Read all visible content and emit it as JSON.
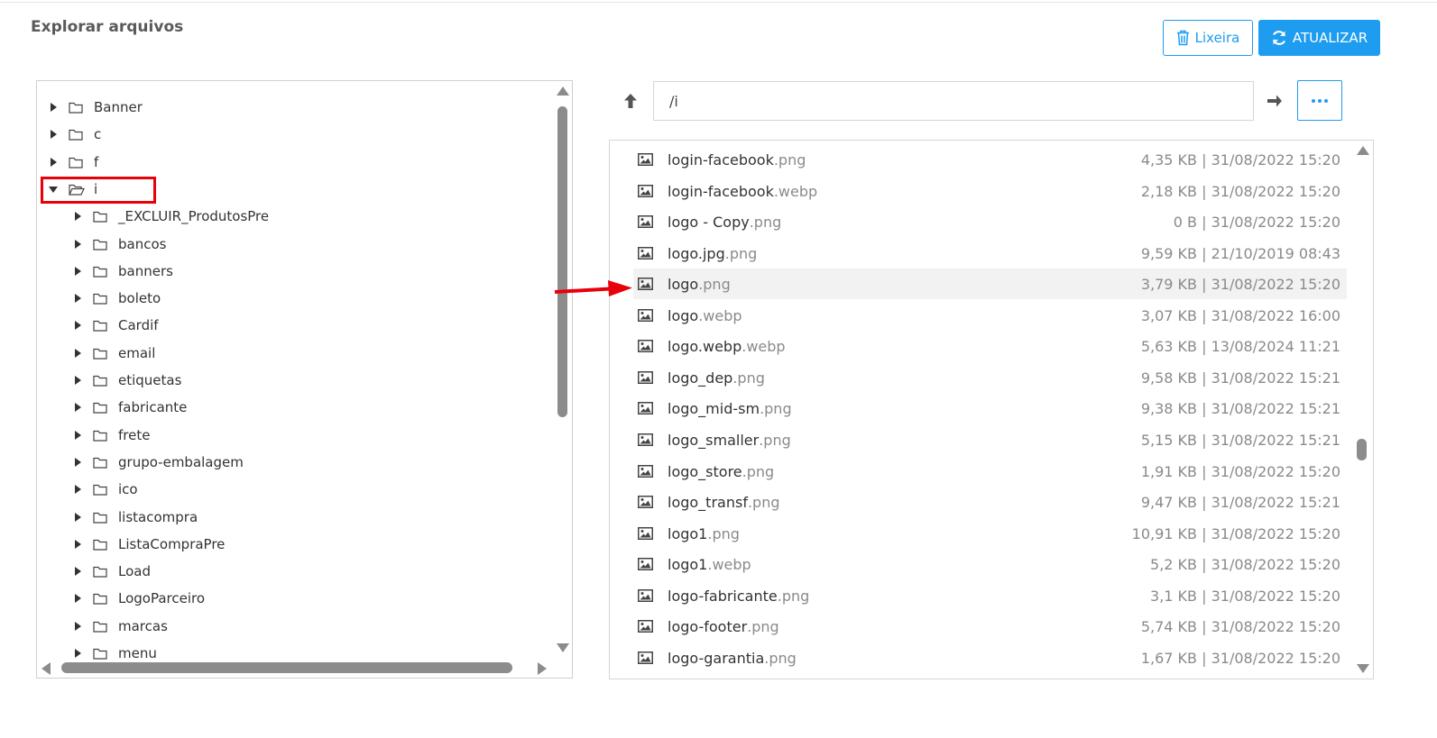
{
  "page": {
    "title": "Explorar arquivos"
  },
  "toolbar": {
    "trash_label": "Lixeira",
    "refresh_label": "ATUALIZAR"
  },
  "colors": {
    "accent": "#1e9cf0",
    "annotation_red": "#e8000b"
  },
  "tree": {
    "root_items": [
      {
        "label": "Banner",
        "expanded": false
      },
      {
        "label": "c",
        "expanded": false
      },
      {
        "label": "f",
        "expanded": false
      },
      {
        "label": "i",
        "expanded": true
      }
    ],
    "children": [
      "_EXCLUIR_ProdutosPre",
      "bancos",
      "banners",
      "boleto",
      "Cardif",
      "email",
      "etiquetas",
      "fabricante",
      "frete",
      "grupo-embalagem",
      "ico",
      "listacompra",
      "ListaCompraPre",
      "Load",
      "LogoParceiro",
      "marcas",
      "menu"
    ]
  },
  "pathbar": {
    "path": "/i"
  },
  "files": [
    {
      "name": "login-facebook",
      "ext": ".png",
      "meta": "4,35 KB | 31/08/2022 15:20"
    },
    {
      "name": "login-facebook",
      "ext": ".webp",
      "meta": "2,18 KB | 31/08/2022 15:20"
    },
    {
      "name": "logo - Copy",
      "ext": ".png",
      "meta": "0 B | 31/08/2022 15:20"
    },
    {
      "name": "logo.jpg",
      "ext": ".png",
      "meta": "9,59 KB | 21/10/2019 08:43"
    },
    {
      "name": "logo",
      "ext": ".png",
      "meta": "3,79 KB | 31/08/2022 15:20",
      "selected": true
    },
    {
      "name": "logo",
      "ext": ".webp",
      "meta": "3,07 KB | 31/08/2022 16:00"
    },
    {
      "name": "logo.webp",
      "ext": ".webp",
      "meta": "5,63 KB | 13/08/2024 11:21"
    },
    {
      "name": "logo_dep",
      "ext": ".png",
      "meta": "9,58 KB | 31/08/2022 15:21"
    },
    {
      "name": "logo_mid-sm",
      "ext": ".png",
      "meta": "9,38 KB | 31/08/2022 15:21"
    },
    {
      "name": "logo_smaller",
      "ext": ".png",
      "meta": "5,15 KB | 31/08/2022 15:21"
    },
    {
      "name": "logo_store",
      "ext": ".png",
      "meta": "1,91 KB | 31/08/2022 15:20"
    },
    {
      "name": "logo_transf",
      "ext": ".png",
      "meta": "9,47 KB | 31/08/2022 15:21"
    },
    {
      "name": "logo1",
      "ext": ".png",
      "meta": "10,91 KB | 31/08/2022 15:20"
    },
    {
      "name": "logo1",
      "ext": ".webp",
      "meta": "5,2 KB | 31/08/2022 15:20"
    },
    {
      "name": "logo-fabricante",
      "ext": ".png",
      "meta": "3,1 KB | 31/08/2022 15:20"
    },
    {
      "name": "logo-footer",
      "ext": ".png",
      "meta": "5,74 KB | 31/08/2022 15:20"
    },
    {
      "name": "logo-garantia",
      "ext": ".png",
      "meta": "1,67 KB | 31/08/2022 15:20"
    }
  ]
}
